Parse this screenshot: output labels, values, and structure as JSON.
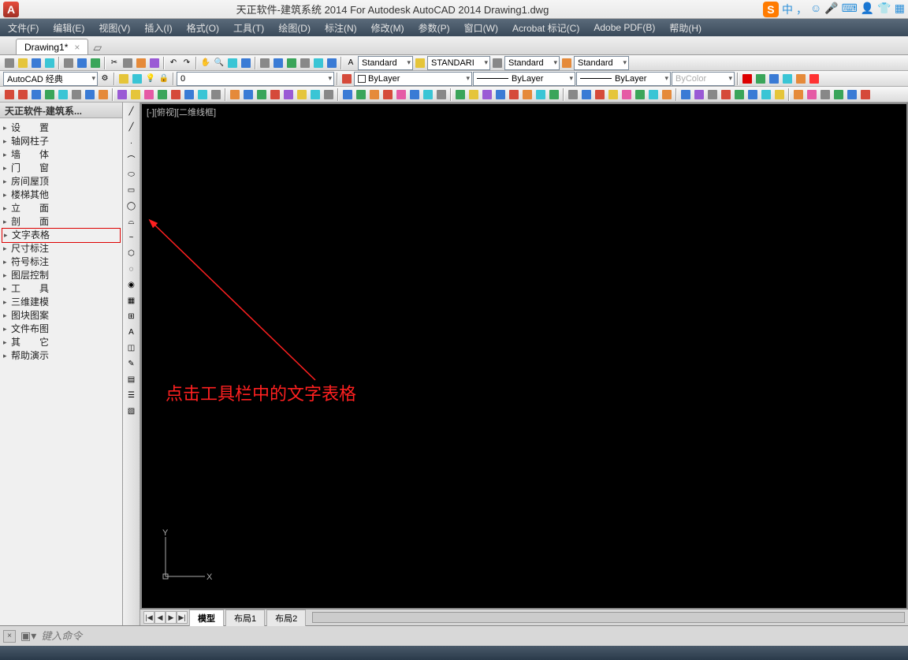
{
  "title": "天正软件-建筑系统 2014  For Autodesk AutoCAD 2014   Drawing1.dwg",
  "ime": {
    "badge": "S",
    "text": "中"
  },
  "menu": [
    "文件(F)",
    "编辑(E)",
    "视图(V)",
    "插入(I)",
    "格式(O)",
    "工具(T)",
    "绘图(D)",
    "标注(N)",
    "修改(M)",
    "参数(P)",
    "窗口(W)",
    "Acrobat 标记(C)",
    "Adobe PDF(B)",
    "帮助(H)"
  ],
  "filetab": {
    "name": "Drawing1*"
  },
  "workspace": "AutoCAD 经典",
  "coord_field": "0",
  "styles_row": [
    "Standard",
    "STANDARI",
    "Standard",
    "Standard"
  ],
  "layer": {
    "name": "ByLayer",
    "linetype": "ByLayer",
    "lineweight": "ByLayer",
    "color": "ByColor"
  },
  "left_panel_title": "天正软件-建筑系...",
  "tree_items": [
    "设　　置",
    "轴网柱子",
    "墙　　体",
    "门　　窗",
    "房间屋顶",
    "楼梯其他",
    "立　　面",
    "剖　　面",
    "文字表格",
    "尺寸标注",
    "符号标注",
    "图层控制",
    "工　　具",
    "三维建模",
    "图块图案",
    "文件布图",
    "其　　它",
    "帮助演示"
  ],
  "highlight_index": 8,
  "viewport_label": "[-][俯视][二维线框]",
  "ucs": {
    "x": "X",
    "y": "Y"
  },
  "annotation": "点击工具栏中的文字表格",
  "model_tabs": {
    "nav": [
      "|◀",
      "◀",
      "▶",
      "▶|"
    ],
    "tabs": [
      "模型",
      "布局1",
      "布局2"
    ]
  },
  "cmd": {
    "placeholder": "键入命令",
    "prompt": "▣▾"
  }
}
